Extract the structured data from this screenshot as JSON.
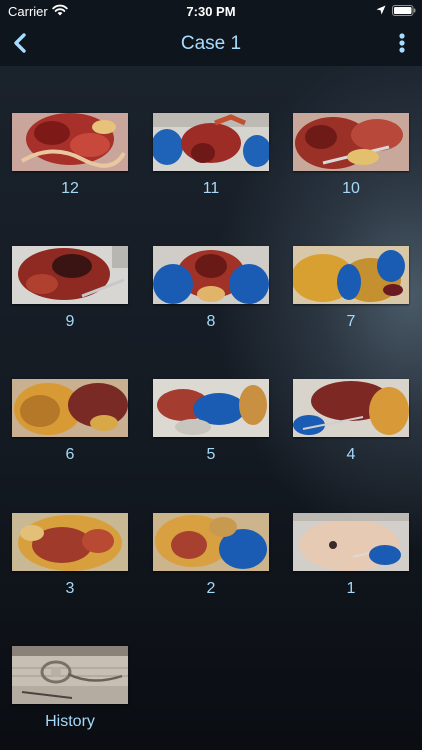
{
  "status_bar": {
    "carrier": "Carrier",
    "time": "7:30 PM",
    "icons": [
      "wifi-icon",
      "location-icon",
      "battery-icon"
    ]
  },
  "nav": {
    "title": "Case 1",
    "back_icon": "chevron-left-icon",
    "more_icon": "more-vertical-icon"
  },
  "colors": {
    "accent": "#a8ddff",
    "label": "#a6d9f7",
    "header_bg": "#0f151c",
    "content_bg": "#141a22"
  },
  "grid": {
    "items": [
      {
        "label": "12",
        "thumbnail": "dissection-photo"
      },
      {
        "label": "11",
        "thumbnail": "dissection-photo"
      },
      {
        "label": "10",
        "thumbnail": "dissection-photo"
      },
      {
        "label": "9",
        "thumbnail": "dissection-photo"
      },
      {
        "label": "8",
        "thumbnail": "dissection-photo"
      },
      {
        "label": "7",
        "thumbnail": "dissection-photo"
      },
      {
        "label": "6",
        "thumbnail": "dissection-photo"
      },
      {
        "label": "5",
        "thumbnail": "dissection-photo"
      },
      {
        "label": "4",
        "thumbnail": "dissection-photo"
      },
      {
        "label": "3",
        "thumbnail": "dissection-photo"
      },
      {
        "label": "2",
        "thumbnail": "dissection-photo"
      },
      {
        "label": "1",
        "thumbnail": "dissection-photo"
      },
      {
        "label": "History",
        "thumbnail": "stethoscope-photo"
      }
    ]
  }
}
